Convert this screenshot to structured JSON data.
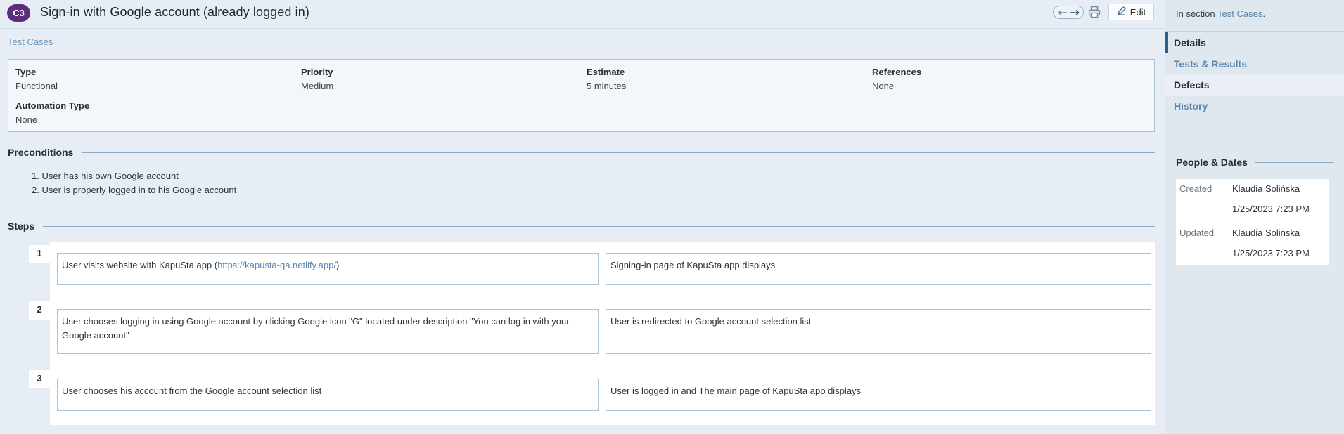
{
  "case": {
    "id": "C3",
    "title": "Sign-in with Google account (already logged in)"
  },
  "toolbar": {
    "edit_label": "Edit",
    "icons": [
      "arrow-left-icon",
      "arrow-right-icon",
      "print-icon",
      "pencil-icon"
    ]
  },
  "breadcrumb": "Test Cases",
  "fields": {
    "type": {
      "label": "Type",
      "value": "Functional"
    },
    "priority": {
      "label": "Priority",
      "value": "Medium"
    },
    "estimate": {
      "label": "Estimate",
      "value": "5 minutes"
    },
    "references": {
      "label": "References",
      "value": "None"
    },
    "automation": {
      "label": "Automation Type",
      "value": "None"
    }
  },
  "preconditions": {
    "heading": "Preconditions",
    "items": [
      "1. User has his own Google account",
      "2. User is properly logged in to his Google account"
    ]
  },
  "steps": {
    "heading": "Steps",
    "items": [
      {
        "number": "1",
        "action_text": "User visits website with KapuSta app (",
        "action_link": "https://kapusta-qa.netlify.app/",
        "action_suffix": ")",
        "expected": "Signing-in page of KapuSta app displays"
      },
      {
        "number": "2",
        "action": "User chooses logging in using Google account by clicking Google icon \"G\" located under description \"You can log in with your Google account\"",
        "expected": "User is redirected to Google account selection list"
      },
      {
        "number": "3",
        "action": "User chooses his account from the Google account selection list",
        "expected": "User is logged in and The main page of KapuSta app displays"
      }
    ]
  },
  "sidebar": {
    "section_prefix": "In section ",
    "section_link": "Test Cases",
    "section_suffix": ".",
    "tabs": [
      "Details",
      "Tests & Results",
      "Defects",
      "History"
    ],
    "people_heading": "People & Dates",
    "created_label": "Created",
    "created_by": "Klaudia Solińska",
    "created_at": "1/25/2023 7:23 PM",
    "updated_label": "Updated",
    "updated_by": "Klaudia Solińska",
    "updated_at": "1/25/2023 7:23 PM"
  },
  "colors": {
    "badge": "#5c2d7c",
    "link": "#5b86ad",
    "background": "#e6edf4",
    "sidebar": "#dfe7ef"
  }
}
